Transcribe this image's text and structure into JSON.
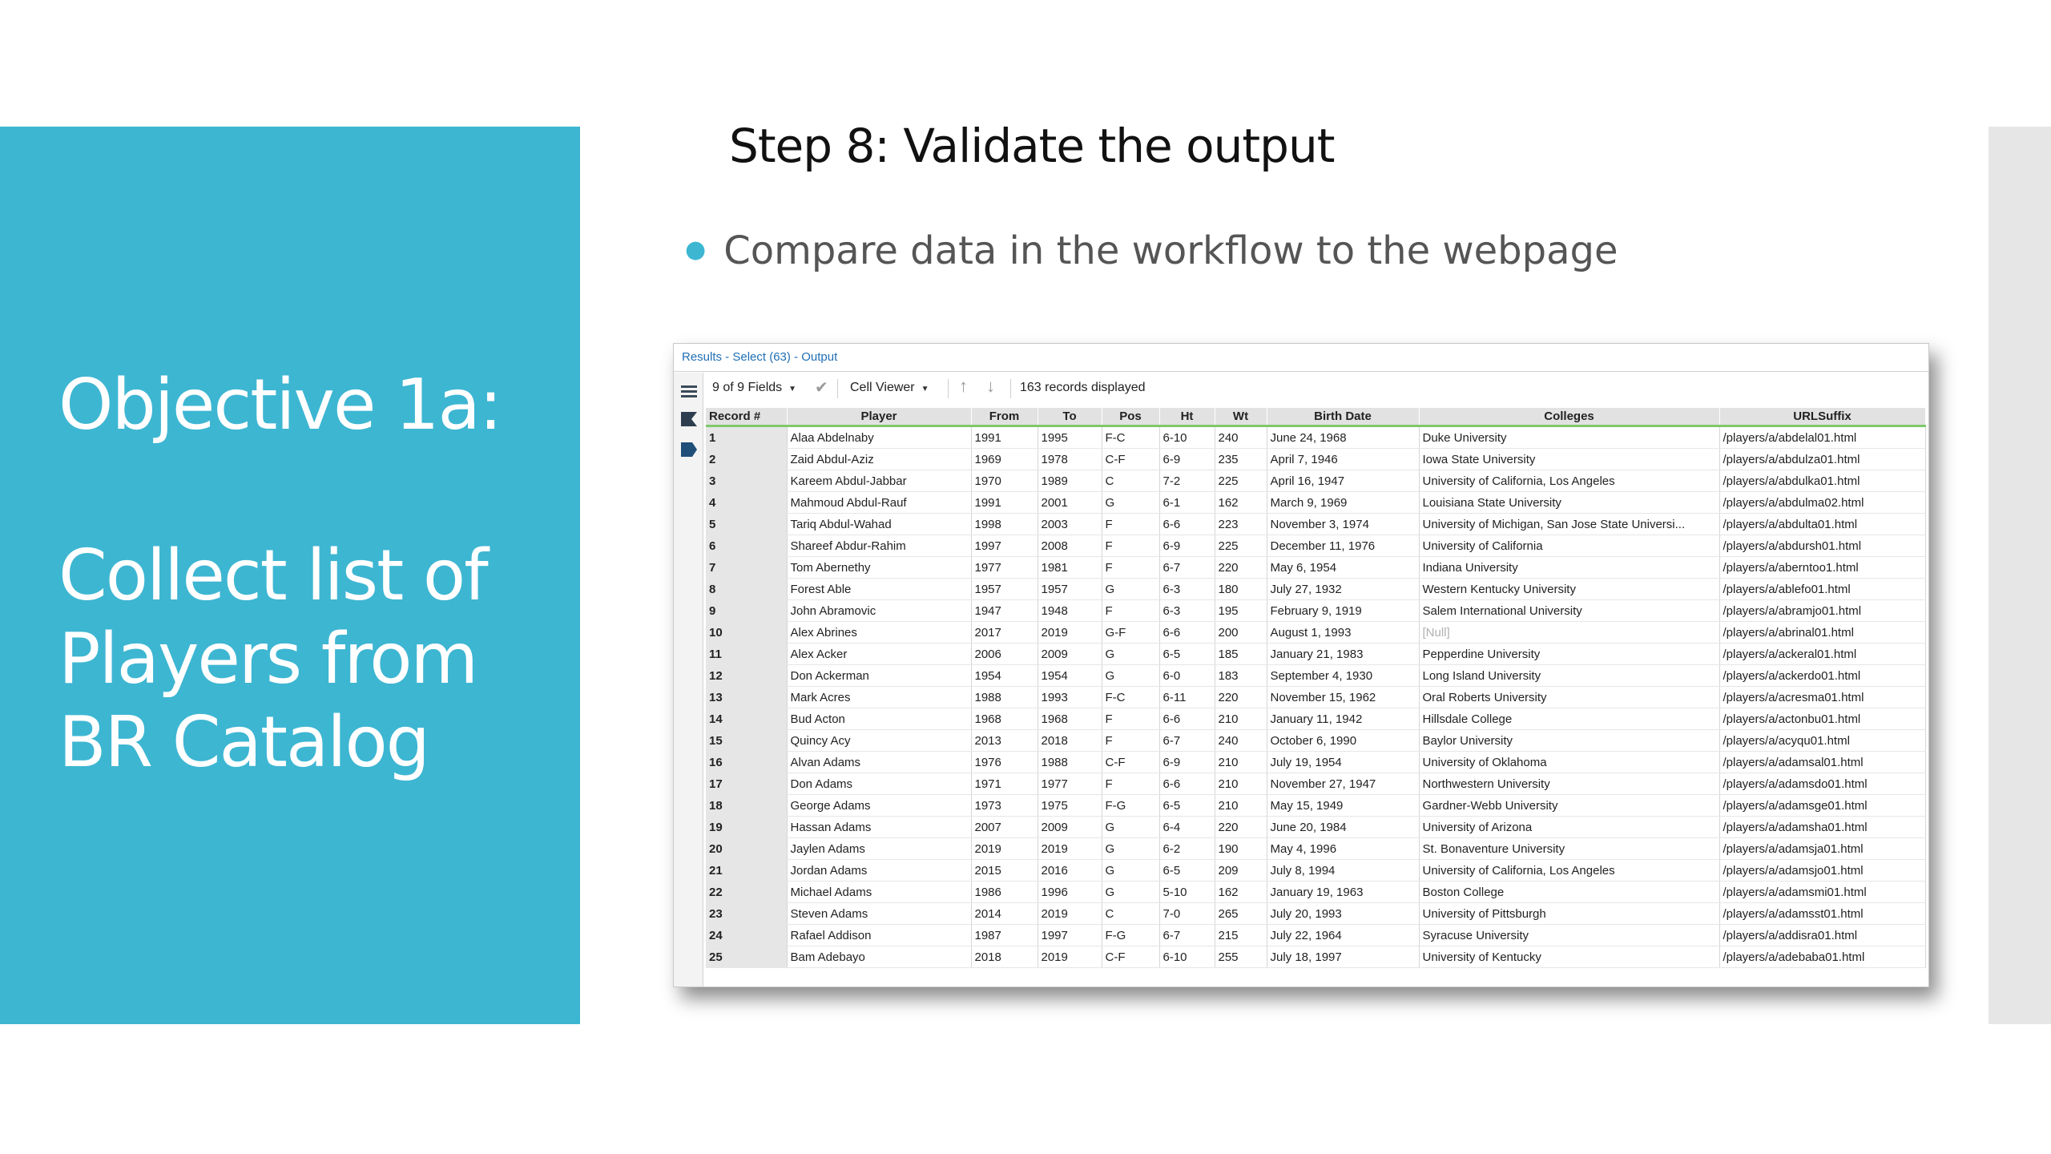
{
  "slide": {
    "objective_title": "Objective 1a:",
    "objective_subtitle": "Collect list of Players from BR Catalog",
    "step_title": "Step 8: Validate the output",
    "bullet": "Compare data in the workflow to the webpage",
    "accent_color": "#3db6d2"
  },
  "results_window": {
    "title": "Results - Select (63) - Output",
    "fields_selector": "9 of 9 Fields",
    "viewer_selector": "Cell Viewer",
    "records_displayed": "163 records displayed",
    "header_underline_color": "#7fc96a",
    "icons": [
      "list-view-icon",
      "table-icon",
      "metadata-icon",
      "checkmark-icon",
      "sort-up-icon",
      "sort-down-icon"
    ],
    "columns": [
      "Record #",
      "Player",
      "From",
      "To",
      "Pos",
      "Ht",
      "Wt",
      "Birth Date",
      "Colleges",
      "URLSuffix"
    ],
    "rows": [
      [
        "1",
        "Alaa Abdelnaby",
        "1991",
        "1995",
        "F-C",
        "6-10",
        "240",
        "June 24, 1968",
        "Duke University",
        "/players/a/abdelal01.html"
      ],
      [
        "2",
        "Zaid Abdul-Aziz",
        "1969",
        "1978",
        "C-F",
        "6-9",
        "235",
        "April 7, 1946",
        "Iowa State University",
        "/players/a/abdulza01.html"
      ],
      [
        "3",
        "Kareem Abdul-Jabbar",
        "1970",
        "1989",
        "C",
        "7-2",
        "225",
        "April 16, 1947",
        "University of California, Los Angeles",
        "/players/a/abdulka01.html"
      ],
      [
        "4",
        "Mahmoud Abdul-Rauf",
        "1991",
        "2001",
        "G",
        "6-1",
        "162",
        "March 9, 1969",
        "Louisiana State University",
        "/players/a/abdulma02.html"
      ],
      [
        "5",
        "Tariq Abdul-Wahad",
        "1998",
        "2003",
        "F",
        "6-6",
        "223",
        "November 3, 1974",
        "University of Michigan, San Jose State Universi...",
        "/players/a/abdulta01.html"
      ],
      [
        "6",
        "Shareef Abdur-Rahim",
        "1997",
        "2008",
        "F",
        "6-9",
        "225",
        "December 11, 1976",
        "University of California",
        "/players/a/abdursh01.html"
      ],
      [
        "7",
        "Tom Abernethy",
        "1977",
        "1981",
        "F",
        "6-7",
        "220",
        "May 6, 1954",
        "Indiana University",
        "/players/a/aberntoo1.html"
      ],
      [
        "8",
        "Forest Able",
        "1957",
        "1957",
        "G",
        "6-3",
        "180",
        "July 27, 1932",
        "Western Kentucky University",
        "/players/a/ablefo01.html"
      ],
      [
        "9",
        "John Abramovic",
        "1947",
        "1948",
        "F",
        "6-3",
        "195",
        "February 9, 1919",
        "Salem International University",
        "/players/a/abramjo01.html"
      ],
      [
        "10",
        "Alex Abrines",
        "2017",
        "2019",
        "G-F",
        "6-6",
        "200",
        "August 1, 1993",
        "[Null]",
        "/players/a/abrinal01.html"
      ],
      [
        "11",
        "Alex Acker",
        "2006",
        "2009",
        "G",
        "6-5",
        "185",
        "January 21, 1983",
        "Pepperdine University",
        "/players/a/ackeral01.html"
      ],
      [
        "12",
        "Don Ackerman",
        "1954",
        "1954",
        "G",
        "6-0",
        "183",
        "September 4, 1930",
        "Long Island University",
        "/players/a/ackerdo01.html"
      ],
      [
        "13",
        "Mark Acres",
        "1988",
        "1993",
        "F-C",
        "6-11",
        "220",
        "November 15, 1962",
        "Oral Roberts University",
        "/players/a/acresma01.html"
      ],
      [
        "14",
        "Bud Acton",
        "1968",
        "1968",
        "F",
        "6-6",
        "210",
        "January 11, 1942",
        "Hillsdale College",
        "/players/a/actonbu01.html"
      ],
      [
        "15",
        "Quincy Acy",
        "2013",
        "2018",
        "F",
        "6-7",
        "240",
        "October 6, 1990",
        "Baylor University",
        "/players/a/acyqu01.html"
      ],
      [
        "16",
        "Alvan Adams",
        "1976",
        "1988",
        "C-F",
        "6-9",
        "210",
        "July 19, 1954",
        "University of Oklahoma",
        "/players/a/adamsal01.html"
      ],
      [
        "17",
        "Don Adams",
        "1971",
        "1977",
        "F",
        "6-6",
        "210",
        "November 27, 1947",
        "Northwestern University",
        "/players/a/adamsdo01.html"
      ],
      [
        "18",
        "George Adams",
        "1973",
        "1975",
        "F-G",
        "6-5",
        "210",
        "May 15, 1949",
        "Gardner-Webb University",
        "/players/a/adamsge01.html"
      ],
      [
        "19",
        "Hassan Adams",
        "2007",
        "2009",
        "G",
        "6-4",
        "220",
        "June 20, 1984",
        "University of Arizona",
        "/players/a/adamsha01.html"
      ],
      [
        "20",
        "Jaylen Adams",
        "2019",
        "2019",
        "G",
        "6-2",
        "190",
        "May 4, 1996",
        "St. Bonaventure University",
        "/players/a/adamsja01.html"
      ],
      [
        "21",
        "Jordan Adams",
        "2015",
        "2016",
        "G",
        "6-5",
        "209",
        "July 8, 1994",
        "University of California, Los Angeles",
        "/players/a/adamsjo01.html"
      ],
      [
        "22",
        "Michael Adams",
        "1986",
        "1996",
        "G",
        "5-10",
        "162",
        "January 19, 1963",
        "Boston College",
        "/players/a/adamsmi01.html"
      ],
      [
        "23",
        "Steven Adams",
        "2014",
        "2019",
        "C",
        "7-0",
        "265",
        "July 20, 1993",
        "University of Pittsburgh",
        "/players/a/adamsst01.html"
      ],
      [
        "24",
        "Rafael Addison",
        "1987",
        "1997",
        "F-G",
        "6-7",
        "215",
        "July 22, 1964",
        "Syracuse University",
        "/players/a/addisra01.html"
      ],
      [
        "25",
        "Bam Adebayo",
        "2018",
        "2019",
        "C-F",
        "6-10",
        "255",
        "July 18, 1997",
        "University of Kentucky",
        "/players/a/adebaba01.html"
      ]
    ]
  }
}
